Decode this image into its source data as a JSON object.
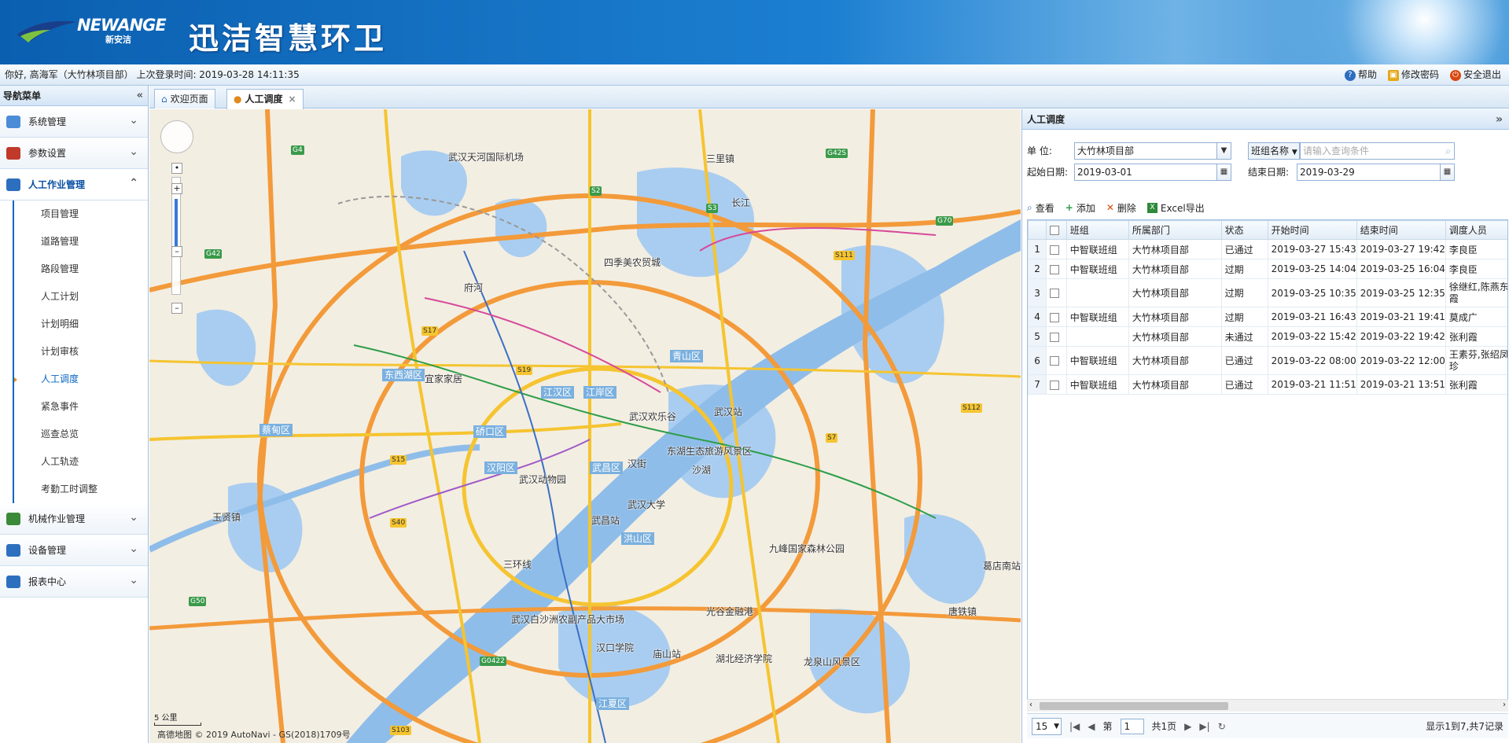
{
  "header": {
    "brand": "NEWANGE",
    "brand_sub": "新安洁",
    "title": "迅洁智慧环卫"
  },
  "topbar": {
    "welcome": "你好, 高海军（大竹林项目部）   上次登录时间: 2019-03-28 14:11:35",
    "help": "帮助",
    "change_password": "修改密码",
    "logout": "安全退出"
  },
  "sidebar": {
    "title": "导航菜单",
    "groups": [
      {
        "label": "系统管理",
        "icon": "gear-icon",
        "color": "#4a8cd6"
      },
      {
        "label": "参数设置",
        "icon": "chart-icon",
        "color": "#c0392b"
      },
      {
        "label": "人工作业管理",
        "icon": "list-icon",
        "color": "#2d6fbf"
      }
    ],
    "sub_items": [
      "项目管理",
      "道路管理",
      "路段管理",
      "人工计划",
      "计划明细",
      "计划审核",
      "人工调度",
      "紧急事件",
      "巡查总览",
      "人工轨迹",
      "考勤工时调整"
    ],
    "groups_after": [
      {
        "label": "机械作业管理",
        "icon": "truck-icon",
        "color": "#3a8a3a"
      },
      {
        "label": "设备管理",
        "icon": "monitor-icon",
        "color": "#2d6fbf"
      },
      {
        "label": "报表中心",
        "icon": "report-icon",
        "color": "#2d6fbf"
      }
    ]
  },
  "tabs": [
    {
      "label": "欢迎页面"
    },
    {
      "label": "人工调度"
    }
  ],
  "map": {
    "labels": [
      "武汉天河国际机场",
      "三里镇",
      "四季美农贸城",
      "府河",
      "东西湖区",
      "宜家家居",
      "蔡甸区",
      "硚口区",
      "江汉区",
      "江岸区",
      "武汉欢乐谷",
      "武汉站",
      "青山区",
      "汉阳区",
      "武汉动物园",
      "武昌区",
      "东湖生态旅游风景区",
      "汉街",
      "武汉大学",
      "武昌站",
      "洪山区",
      "九峰国家森林公园",
      "葛店南站",
      "武汉白沙洲农副产品大市场",
      "光谷金融港",
      "汉口学院",
      "庙山站",
      "湖北经济学院",
      "龙泉山风景区",
      "江夏区",
      "玉贤镇",
      "唐铁镇",
      "三环线",
      "长江",
      "沙湖"
    ],
    "highways": [
      "G42",
      "G4",
      "S2",
      "S3",
      "G42S",
      "G70",
      "S111",
      "S17",
      "S19",
      "S15",
      "S40",
      "S7",
      "G50",
      "G0422",
      "S103",
      "S112"
    ],
    "scale": "5 公里",
    "copyright": "高德地图 © 2019 AutoNavi - GS(2018)1709号"
  },
  "panel": {
    "title": "人工调度",
    "unit_label": "单    位:",
    "unit_value": "大竹林项目部",
    "group_label": "班组名称",
    "search_placeholder": "请输入查询条件",
    "start_label": "起始日期:",
    "start_value": "2019-03-01",
    "end_label": "结束日期:",
    "end_value": "2019-03-29",
    "toolbar": {
      "view": "查看",
      "add": "添加",
      "delete": "删除",
      "export": "Excel导出"
    },
    "columns": [
      "班组",
      "所属部门",
      "状态",
      "开始时间",
      "结束时间",
      "调度人员"
    ],
    "rows": [
      {
        "n": "1",
        "team": "中智联班组",
        "dept": "大竹林项目部",
        "status": "已通过",
        "start": "2019-03-27 15:43",
        "end": "2019-03-27 19:42",
        "staff": "李良臣"
      },
      {
        "n": "2",
        "team": "中智联班组",
        "dept": "大竹林项目部",
        "status": "过期",
        "start": "2019-03-25 14:04",
        "end": "2019-03-25 16:04",
        "staff": "李良臣"
      },
      {
        "n": "3",
        "team": "",
        "dept": "大竹林项目部",
        "status": "过期",
        "start": "2019-03-25 10:35",
        "end": "2019-03-25 12:35",
        "staff": "徐继红,陈燕东霞"
      },
      {
        "n": "4",
        "team": "中智联班组",
        "dept": "大竹林项目部",
        "status": "过期",
        "start": "2019-03-21 16:43",
        "end": "2019-03-21 19:41",
        "staff": "莫成广"
      },
      {
        "n": "5",
        "team": "",
        "dept": "大竹林项目部",
        "status": "未通过",
        "start": "2019-03-22 15:42",
        "end": "2019-03-22 19:42",
        "staff": "张利霞"
      },
      {
        "n": "6",
        "team": "中智联班组",
        "dept": "大竹林项目部",
        "status": "已通过",
        "start": "2019-03-22 08:00",
        "end": "2019-03-22 12:00",
        "staff": "王素芬,张绍凤珍"
      },
      {
        "n": "7",
        "team": "中智联班组",
        "dept": "大竹林项目部",
        "status": "已通过",
        "start": "2019-03-21 11:51",
        "end": "2019-03-21 13:51",
        "staff": "张利霞"
      }
    ],
    "pager": {
      "page_size": "15",
      "page_prefix": "第",
      "page": "1",
      "page_total": "共1页",
      "summary": "显示1到7,共7记录"
    }
  }
}
